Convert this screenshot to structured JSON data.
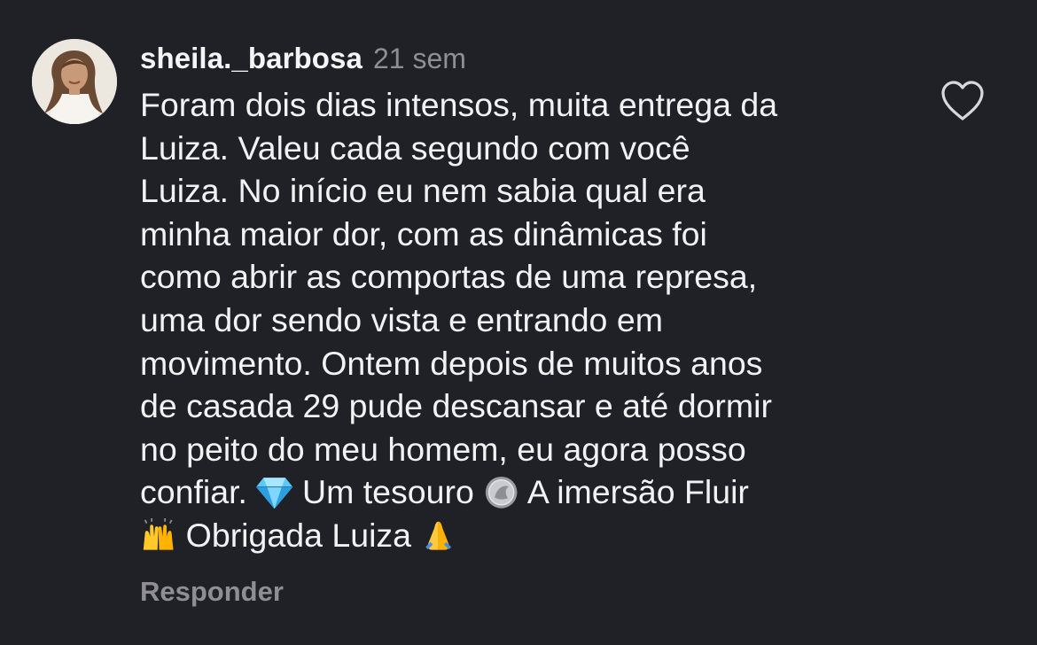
{
  "comment": {
    "username": "sheila._barbosa",
    "timestamp": "21 sem",
    "lines": [
      "Foram dois dias intensos, muita entrega da",
      "Luiza. Valeu cada segundo com você",
      "Luiza. No início eu nem sabia qual era",
      "minha maior dor, com as dinâmicas foi",
      "como abrir as comportas de uma represa,",
      "uma dor sendo vista e entrando em",
      "movimento. Ontem depois de muitos anos",
      "de casada  29 pude descansar e até dormir",
      "no peito do meu homem, eu agora posso"
    ],
    "line10": {
      "part1": "confiar. ",
      "part2": " Um tesouro ",
      "part3": " A imersão Fluir"
    },
    "line11": {
      "part1": " Obrigada Luiza "
    },
    "emojis": [
      "gem-emoji",
      "coin-emoji",
      "raising-hands-emoji",
      "folded-hands-emoji"
    ],
    "reply_label": "Responder",
    "like_icon": "heart-outline-icon"
  },
  "colors": {
    "background": "#202127",
    "text": "#f2f2f4",
    "muted": "#8e8e93"
  }
}
